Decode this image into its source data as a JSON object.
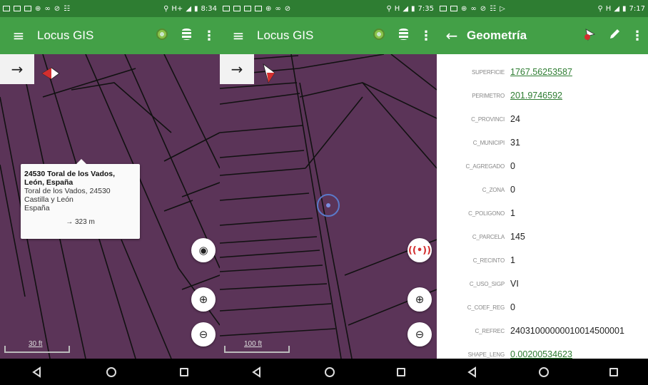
{
  "panel1": {
    "status": {
      "time": "8:34",
      "net": "H+"
    },
    "app_title": "Locus GIS",
    "popup": {
      "title": "24530 Toral de los Vados, León, España",
      "address1": "Toral de los Vados, 24530",
      "address2": "Castilla y León",
      "address3": "España",
      "distance": "→ 323 m"
    },
    "scale_label": "30 ft"
  },
  "panel2": {
    "status": {
      "time": "7:35",
      "net": "H"
    },
    "app_title": "Locus GIS",
    "scale_label": "100 ft"
  },
  "panel3": {
    "status": {
      "time": "7:17",
      "net": "H"
    },
    "title": "Geometría",
    "properties": [
      {
        "key": "SUPERFICIE",
        "value": "1767.56253587",
        "link": true
      },
      {
        "key": "PERIMETRO",
        "value": "201.9746592",
        "link": true
      },
      {
        "key": "C_PROVINCI",
        "value": "24",
        "link": false
      },
      {
        "key": "C_MUNICIPI",
        "value": "31",
        "link": false
      },
      {
        "key": "C_AGREGADO",
        "value": "0",
        "link": false
      },
      {
        "key": "C_ZONA",
        "value": "0",
        "link": false
      },
      {
        "key": "C_POLIGONO",
        "value": "1",
        "link": false
      },
      {
        "key": "C_PARCELA",
        "value": "145",
        "link": false
      },
      {
        "key": "C_RECINTO",
        "value": "1",
        "link": false
      },
      {
        "key": "C_USO_SIGP",
        "value": "VI",
        "link": false
      },
      {
        "key": "C_COEF_REG",
        "value": "0",
        "link": false
      },
      {
        "key": "C_REFREC",
        "value": "24031000000010014500001",
        "link": false
      },
      {
        "key": "SHAPE_LENG",
        "value": "0.00200534623",
        "link": true
      }
    ]
  },
  "colors": {
    "statusbar": "#2e7d32",
    "appbar": "#43a047",
    "map": "#5b3458",
    "link": "#2e7d32"
  }
}
